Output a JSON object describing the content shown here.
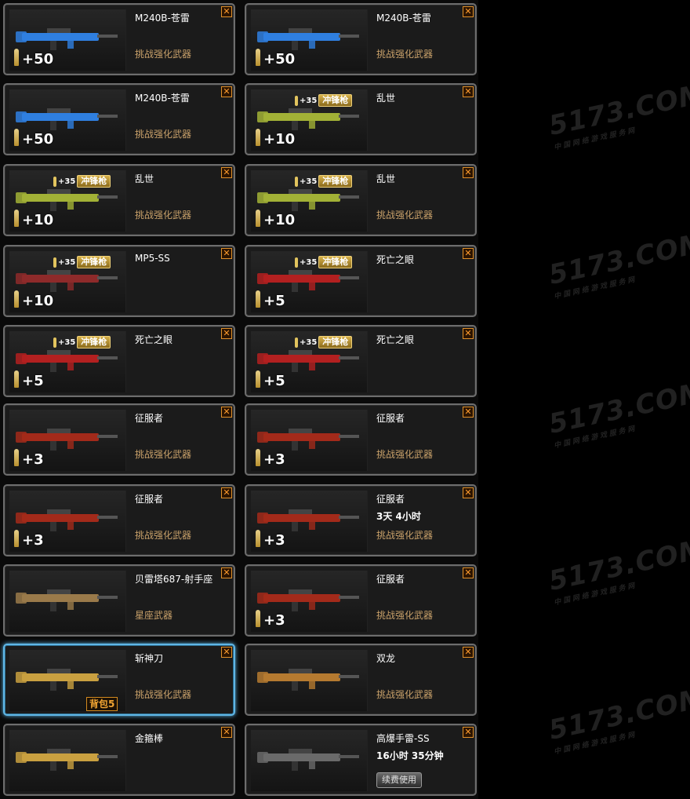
{
  "watermark": {
    "logo": "5173.COM",
    "tagline": "中国网络游戏服务网"
  },
  "colors": {
    "selected_border": "#5fb6e6",
    "note_text": "#c9a16a",
    "close_accent": "#e0902a"
  },
  "close_icon": "✕",
  "slots": [
    {
      "name": "M240B-苍雷",
      "note": "挑战强化武器",
      "level": "+50",
      "weapon_color": "#2f7fe0"
    },
    {
      "name": "M240B-苍雷",
      "note": "挑战强化武器",
      "level": "+50",
      "weapon_color": "#2f7fe0"
    },
    {
      "name": "M240B-苍雷",
      "note": "挑战强化武器",
      "level": "+50",
      "weapon_color": "#2f7fe0"
    },
    {
      "name": "乱世",
      "note": "",
      "level": "+10",
      "weapon_color": "#a2b136",
      "badge_num": "+35",
      "badge_type": "冲锋枪"
    },
    {
      "name": "乱世",
      "note": "挑战强化武器",
      "level": "+10",
      "weapon_color": "#a2b136",
      "badge_num": "+35",
      "badge_type": "冲锋枪"
    },
    {
      "name": "乱世",
      "note": "挑战强化武器",
      "level": "+10",
      "weapon_color": "#a2b136",
      "badge_num": "+35",
      "badge_type": "冲锋枪"
    },
    {
      "name": "MP5-SS",
      "note": "",
      "level": "+10",
      "weapon_color": "#8e2a2a",
      "badge_num": "+35",
      "badge_type": "冲锋枪"
    },
    {
      "name": "死亡之眼",
      "note": "",
      "level": "+5",
      "weapon_color": "#b32020",
      "badge_num": "+35",
      "badge_type": "冲锋枪"
    },
    {
      "name": "死亡之眼",
      "note": "",
      "level": "+5",
      "weapon_color": "#b32020",
      "badge_num": "+35",
      "badge_type": "冲锋枪"
    },
    {
      "name": "死亡之眼",
      "note": "",
      "level": "+5",
      "weapon_color": "#b32020",
      "badge_num": "+35",
      "badge_type": "冲锋枪"
    },
    {
      "name": "征服者",
      "note": "挑战强化武器",
      "level": "+3",
      "weapon_color": "#a32a1a"
    },
    {
      "name": "征服者",
      "note": "挑战强化武器",
      "level": "+3",
      "weapon_color": "#a32a1a"
    },
    {
      "name": "征服者",
      "note": "挑战强化武器",
      "level": "+3",
      "weapon_color": "#a32a1a"
    },
    {
      "name": "征服者",
      "timer": "3天 4小时",
      "note": "挑战强化武器",
      "level": "+3",
      "weapon_color": "#a32a1a"
    },
    {
      "name": "贝雷塔687-射手座",
      "note": "星座武器",
      "weapon_color": "#9a7a4a"
    },
    {
      "name": "征服者",
      "note": "挑战强化武器",
      "level": "+3",
      "weapon_color": "#a32a1a"
    },
    {
      "name": "斩神刀",
      "note": "挑战强化武器",
      "weapon_color": "#c9a040",
      "selected": true,
      "pack_tag": "背包5"
    },
    {
      "name": "双龙",
      "note": "挑战强化武器",
      "weapon_color": "#b57a30"
    },
    {
      "name": "金箍棒",
      "note": "",
      "weapon_color": "#c9a040"
    },
    {
      "name": "高爆手雷-SS",
      "timer": "16小时 35分钟",
      "note": "",
      "weapon_color": "#6a6a6a",
      "renew_button": "续费使用"
    }
  ]
}
